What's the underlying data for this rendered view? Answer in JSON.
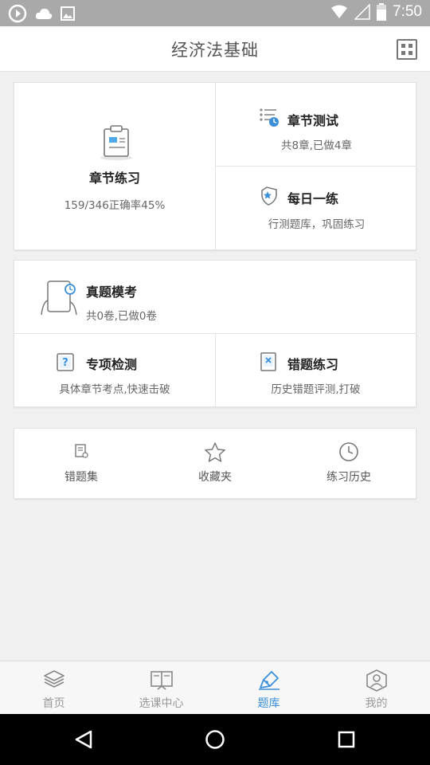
{
  "status_bar": {
    "time": "7:50"
  },
  "header": {
    "title": "经济法基础",
    "menu_icon": "grid-icon"
  },
  "practice": {
    "chapter": {
      "label": "章节练习",
      "stats": "159/346正确率45%"
    },
    "chapter_test": {
      "label": "章节测试",
      "sub": "共8章,已做4章"
    },
    "daily": {
      "label": "每日一练",
      "sub": "行测题库，巩固练习"
    }
  },
  "exam": {
    "mock": {
      "label": "真题模考",
      "sub": "共0卷,已做0卷"
    },
    "special": {
      "label": "专项检测",
      "sub": "具体章节考点,快速击破"
    },
    "wrong_practice": {
      "label": "错题练习",
      "sub": "历史错题评测,打破"
    }
  },
  "tools": [
    {
      "label": "错题集",
      "icon": "note-icon"
    },
    {
      "label": "收藏夹",
      "icon": "star-icon"
    },
    {
      "label": "练习历史",
      "icon": "clock-icon"
    }
  ],
  "tabs": [
    {
      "label": "首页",
      "icon": "layers-icon"
    },
    {
      "label": "选课中心",
      "icon": "book-icon"
    },
    {
      "label": "题库",
      "icon": "pen-icon",
      "active": true
    },
    {
      "label": "我的",
      "icon": "user-icon"
    }
  ],
  "colors": {
    "accent": "#3a8fd8",
    "statusbar": "#a9a9a9",
    "background": "#f0f0f0"
  }
}
